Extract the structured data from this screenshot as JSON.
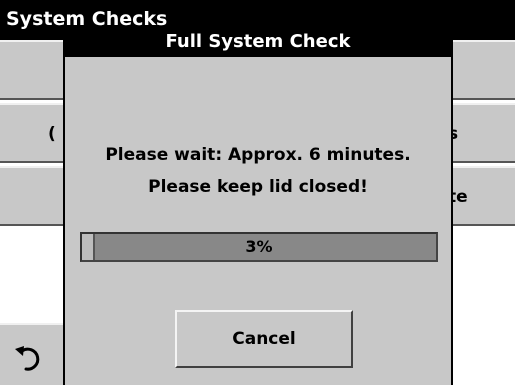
{
  "background_screen": {
    "title": "System Checks",
    "rows": [
      {
        "left_fragment": "",
        "right_fragment": ""
      },
      {
        "left_fragment": "(",
        "right_fragment": "s"
      },
      {
        "left_fragment": "",
        "right_fragment": "te"
      }
    ],
    "footer": {
      "back_icon": "undo-arrow-icon"
    }
  },
  "dialog": {
    "title": "Full System Check",
    "message_line1": "Please wait: Approx. 6 minutes.",
    "message_line2": "Please keep lid closed!",
    "progress": {
      "percent": 3,
      "label": "3%"
    },
    "cancel_label": "Cancel"
  }
}
